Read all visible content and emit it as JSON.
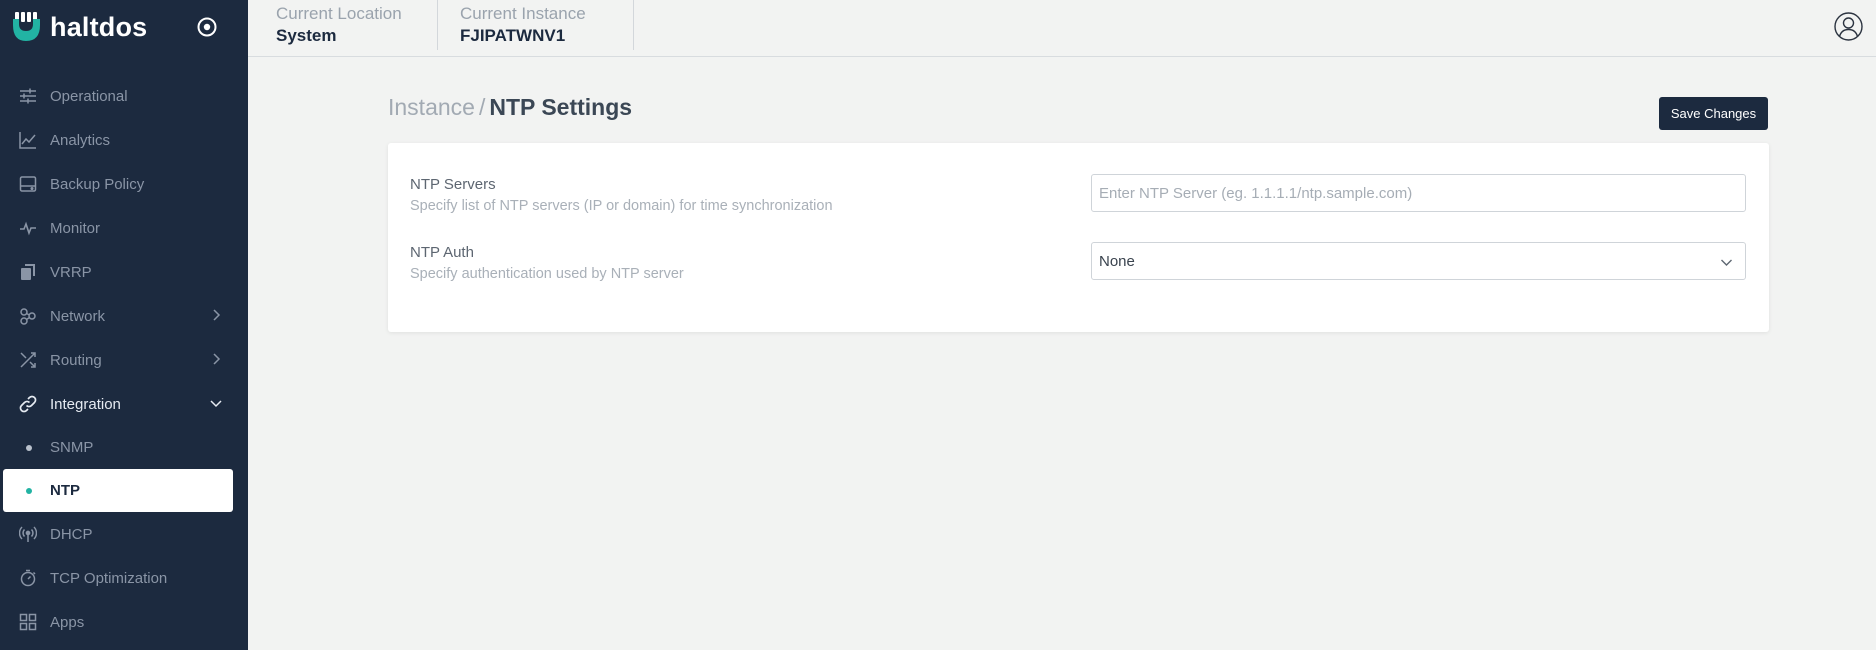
{
  "brand": {
    "name": "haltdos"
  },
  "sidebar": {
    "items": [
      {
        "label": "Operational",
        "icon": "sliders-icon"
      },
      {
        "label": "Analytics",
        "icon": "line-chart-icon"
      },
      {
        "label": "Backup Policy",
        "icon": "hard-drive-icon"
      },
      {
        "label": "Monitor",
        "icon": "pulse-icon"
      },
      {
        "label": "VRRP",
        "icon": "copy-icon"
      },
      {
        "label": "Network",
        "icon": "network-icon"
      },
      {
        "label": "Routing",
        "icon": "shuffle-icon"
      },
      {
        "label": "Integration",
        "icon": "link-icon"
      },
      {
        "label": "SNMP"
      },
      {
        "label": "NTP"
      },
      {
        "label": "DHCP",
        "icon": "antenna-icon"
      },
      {
        "label": "TCP Optimization",
        "icon": "stopwatch-icon"
      },
      {
        "label": "Apps",
        "icon": "grid-icon"
      }
    ]
  },
  "topbar": {
    "location_label": "Current Location",
    "location_value": "System",
    "instance_label": "Current Instance",
    "instance_value": "FJIPATWNV1"
  },
  "breadcrumb": {
    "parent": "Instance",
    "separator": "/",
    "current": "NTP Settings"
  },
  "actions": {
    "save_label": "Save Changes"
  },
  "form": {
    "ntp_servers": {
      "label": "NTP Servers",
      "help": "Specify list of NTP servers (IP or domain) for time synchronization",
      "value": "",
      "placeholder": "Enter NTP Server (eg. 1.1.1.1/ntp.sample.com)"
    },
    "ntp_auth": {
      "label": "NTP Auth",
      "help": "Specify authentication used by NTP server",
      "selected": "None"
    }
  },
  "colors": {
    "sidebar_bg": "#1c2a3f",
    "accent": "#22b3a3",
    "page_bg": "#f2f3f2",
    "button_bg": "#1c2a3f"
  }
}
